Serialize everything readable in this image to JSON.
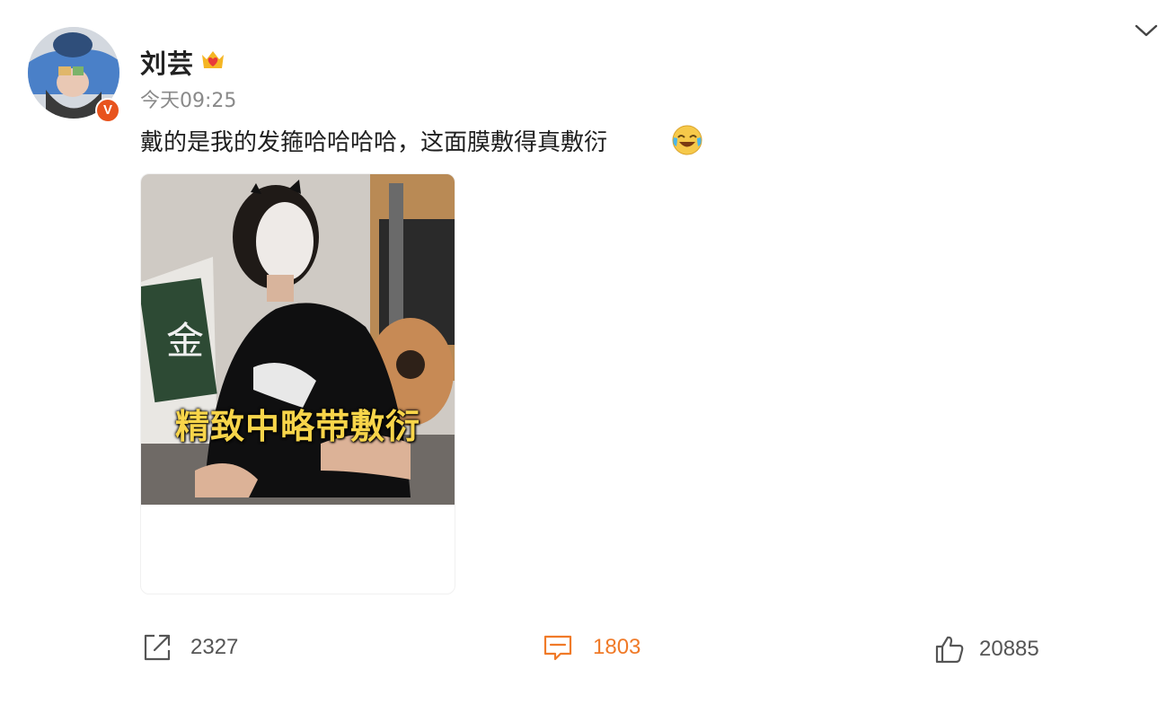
{
  "post": {
    "username": "刘芸",
    "time": "今天09:25",
    "text": "戴的是我的发箍哈哈哈哈，这面膜敷得真敷衍",
    "verified_mark": "V"
  },
  "media": {
    "subtitle": "精致中略带敷衍"
  },
  "actions": {
    "share_count": "2327",
    "comment_count": "1803",
    "like_count": "20885"
  },
  "icons": {
    "badge": "crown-heart-icon",
    "emoji": "laugh-cry-emoji-icon",
    "share": "share-icon",
    "comment": "comment-icon",
    "like": "thumbs-up-icon",
    "dropdown": "chevron-down-icon"
  },
  "colors": {
    "comment_accent": "#f07a28",
    "verified_badge": "#e8531d",
    "subtitle": "#f8d54a"
  }
}
